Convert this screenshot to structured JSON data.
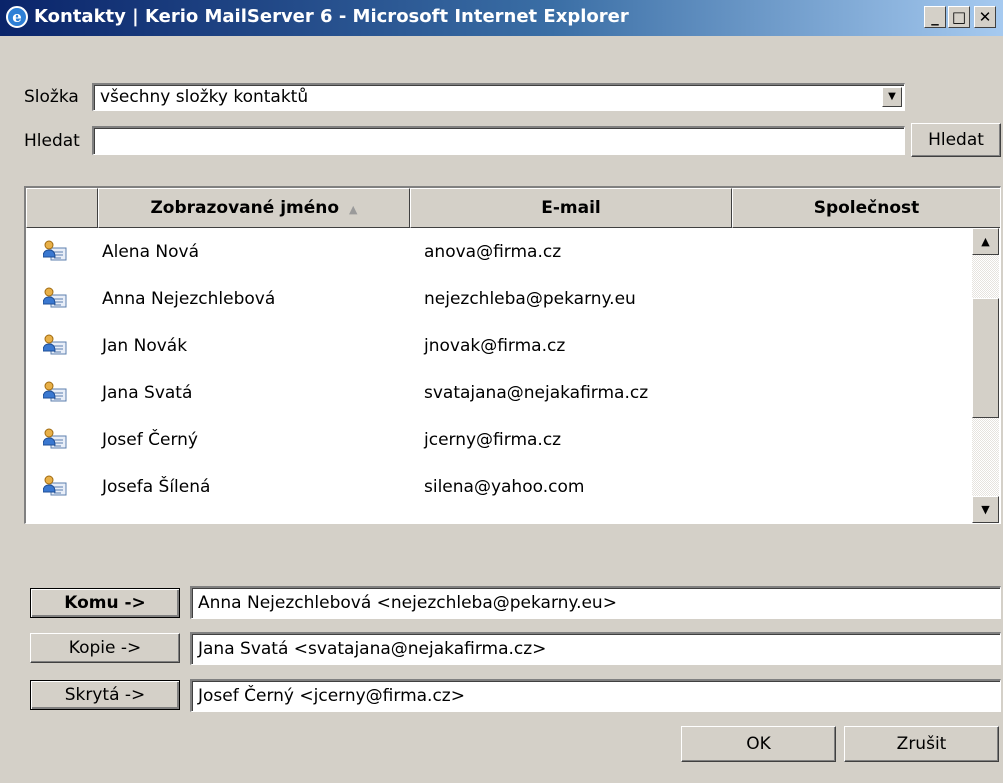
{
  "window": {
    "title": "Kontakty | Kerio MailServer 6 - Microsoft Internet Explorer",
    "icon": "ie-icon",
    "minimize_label": "_",
    "maximize_label": "□",
    "close_label": "✕"
  },
  "folder": {
    "label": "Složka",
    "value": "všechny složky kontaktů"
  },
  "search": {
    "label": "Hledat",
    "value": "",
    "button_label": "Hledat"
  },
  "table": {
    "columns": [
      "Zobrazované jméno",
      "E-mail",
      "Společnost"
    ],
    "sort_indicator": "▲",
    "rows": [
      {
        "name": "Alena Nová",
        "email": "anova@firma.cz",
        "company": ""
      },
      {
        "name": "Anna Nejezchlebová",
        "email": "nejezchleba@pekarny.eu",
        "company": ""
      },
      {
        "name": "Jan Novák",
        "email": "jnovak@firma.cz",
        "company": ""
      },
      {
        "name": "Jana Svatá",
        "email": "svatajana@nejakafirma.cz",
        "company": ""
      },
      {
        "name": "Josef Černý",
        "email": "jcerny@firma.cz",
        "company": ""
      },
      {
        "name": "Josefa Šílená",
        "email": "silena@yahoo.com",
        "company": ""
      }
    ],
    "scroll_up": "▲",
    "scroll_down": "▼"
  },
  "recipients": {
    "to": {
      "button_label": "Komu ->",
      "value": "Anna Nejezchlebová <nejezchleba@pekarny.eu>"
    },
    "cc": {
      "button_label": "Kopie ->",
      "value": "Jana Svatá <svatajana@nejakafirma.cz>"
    },
    "bcc": {
      "button_label": "Skrytá ->",
      "value": "Josef Černý <jcerny@firma.cz>"
    }
  },
  "actions": {
    "ok_label": "OK",
    "cancel_label": "Zrušit"
  },
  "colors": {
    "titlebar_start": "#0a246a",
    "titlebar_end": "#a6caf0",
    "face": "#d4d0c8"
  }
}
